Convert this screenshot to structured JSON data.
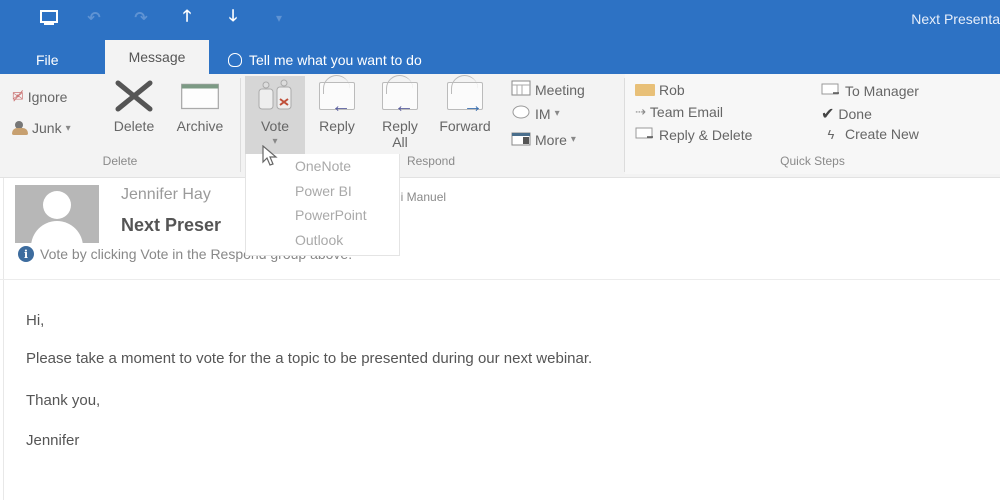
{
  "window": {
    "title": "Next Presenta",
    "quick_access": [
      {
        "icon": "save-icon"
      },
      {
        "icon": "undo-icon"
      },
      {
        "icon": "redo-icon"
      },
      {
        "icon": "up-arrow-icon"
      },
      {
        "icon": "down-arrow-icon"
      },
      {
        "icon": "customize-qat-icon"
      }
    ]
  },
  "tabs": {
    "file": "File",
    "message": "Message",
    "tell_me": "Tell me what you want to do"
  },
  "ribbon": {
    "delete_group": {
      "label": "Delete",
      "ignore": "Ignore",
      "junk": "Junk",
      "junk_caret": "▾",
      "delete": "Delete",
      "archive": "Archive"
    },
    "respond_group": {
      "label": "Respond",
      "vote": "Vote",
      "vote_caret": "▾",
      "reply": "Reply",
      "reply_all_line1": "Reply",
      "reply_all_line2": "All",
      "forward": "Forward",
      "meeting": "Meeting",
      "im": "IM",
      "im_caret": "▾",
      "more": "More",
      "more_caret": "▾"
    },
    "quick_steps_group": {
      "label": "Quick Steps",
      "items": [
        {
          "label": "Rob",
          "icon": "folder-icon"
        },
        {
          "label": "Team Email",
          "icon": "team-email-icon"
        },
        {
          "label": "Reply & Delete",
          "icon": "reply-delete-icon"
        },
        {
          "label": "To Manager",
          "icon": "to-manager-icon"
        },
        {
          "label": "Done",
          "icon": "checkmark-icon"
        },
        {
          "label": "Create New",
          "icon": "lightning-icon"
        }
      ]
    }
  },
  "vote_dropdown": {
    "options": [
      "OneNote",
      "Power BI",
      "PowerPoint",
      "Outlook"
    ]
  },
  "message": {
    "sender": "Jennifer Hay",
    "to": "di Manuel",
    "subject": "Next Preser",
    "info": "Vote by clicking Vote in the Respond group above.",
    "body": [
      "Hi,",
      "Please take a moment to vote for the a topic to be presented during our next webinar.",
      "Thank you,",
      "Jennifer"
    ]
  },
  "colors": {
    "title_bar": "#2d72c4",
    "ribbon_bg": "#f3f3f3",
    "info_icon": "#3d6c9e"
  }
}
